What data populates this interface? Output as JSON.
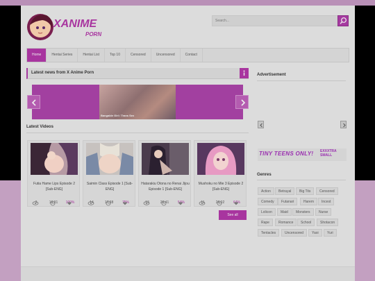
{
  "header": {
    "logo_text_1": "XANIME",
    "logo_text_2": "PORN",
    "search_placeholder": "Search..."
  },
  "nav": {
    "items": [
      {
        "label": "Home"
      },
      {
        "label": "Hentai Series"
      },
      {
        "label": "Hentai List"
      },
      {
        "label": "Top 10"
      },
      {
        "label": "Censored"
      },
      {
        "label": "Uncensored"
      },
      {
        "label": "Contact"
      }
    ]
  },
  "news": {
    "title": "Latest news from X Anime Porn",
    "slide_caption": "Bangable Girl / Trans Sex"
  },
  "latest": {
    "title": "Latest Videos",
    "see_all": "See all",
    "videos": [
      {
        "title": "Futia Hame Lips Episode 2 [Sub-ENG]",
        "views": "3",
        "duration": "16:31",
        "rating": "100%"
      },
      {
        "title": "Saimin Class Episode 1 [Sub-ENG]",
        "views": "14",
        "duration": "17:38",
        "rating": "75%"
      },
      {
        "title": "Hatarakiu Otona no Renai Jijou Episode 1 [Sub-ENG]",
        "views": "13",
        "duration": "26:41",
        "rating": "54%"
      },
      {
        "title": "Mushoku no Mie 3 Episode 2 [Sub-ENG]",
        "views": "11",
        "duration": "26:02",
        "rating": "64%"
      }
    ]
  },
  "sidebar": {
    "ad_title": "Advertisement",
    "banner_text": "TINY TEENS ONLY!",
    "banner_text2": "EXXXTRA SMALL",
    "genres_title": "Genres",
    "genres": [
      "Action",
      "Betrayal",
      "Big Tits",
      "Censored",
      "Comedy",
      "Futanari",
      "Harem",
      "Incest",
      "Lolicon",
      "Maid",
      "Monsters",
      "Nurse",
      "Rape",
      "Romance",
      "School",
      "Shotacon",
      "Tentacles",
      "Uncensored",
      "Yaoi",
      "Yuri"
    ]
  },
  "colors": {
    "accent": "#a8359f"
  }
}
